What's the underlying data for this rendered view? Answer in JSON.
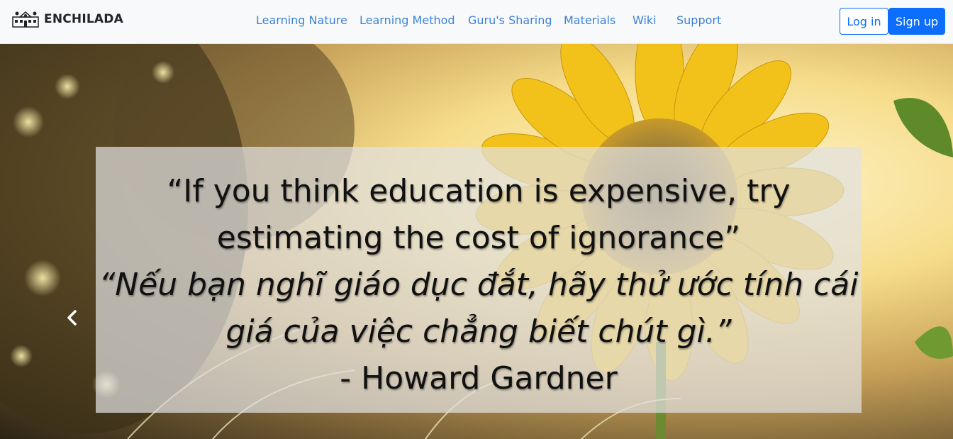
{
  "navbar": {
    "brand": {
      "logo_icon": "school-building-icon",
      "name": "ENCHILADA"
    },
    "links": [
      {
        "label": "Learning Nature"
      },
      {
        "label": "Learning Method"
      },
      {
        "label": "Guru's Sharing"
      },
      {
        "label": "Materials"
      },
      {
        "label": "Wiki"
      },
      {
        "label": "Support"
      }
    ],
    "login_label": "Log in",
    "signup_label": "Sign up"
  },
  "hero": {
    "background": "sunflower-photo",
    "quote_en": "“If you think education is expensive, try estimating the cost of ignorance”",
    "quote_vi": "“Nếu bạn nghĩ giáo dục đắt, hãy thử ước tính cái giá của việc chẳng biết chút gì.”",
    "author": "- Howard Gardner",
    "prev_icon": "chevron-left-icon"
  },
  "colors": {
    "link": "#3b82d6",
    "primary": "#0d6efd",
    "navbar_bg": "#f8f9fa"
  }
}
